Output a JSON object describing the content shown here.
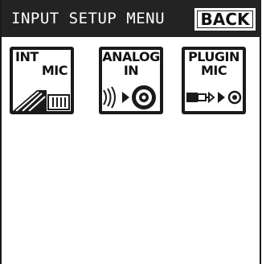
{
  "header": {
    "title": "INPUT SETUP MENU",
    "back_label": "BACK"
  },
  "tiles": [
    {
      "line1": "INT",
      "line2": "MIC",
      "icon": "internal-mic-icon"
    },
    {
      "line1": "ANALOG",
      "line2": "IN",
      "icon": "analog-input-jack-icon"
    },
    {
      "line1": "PLUGIN",
      "line2": "MIC",
      "icon": "plugin-mic-connector-icon"
    }
  ],
  "colors": {
    "header_bg": "#232323",
    "header_text": "#ffffff",
    "tile_border": "#1a1a1a",
    "background": "#ffffff"
  }
}
